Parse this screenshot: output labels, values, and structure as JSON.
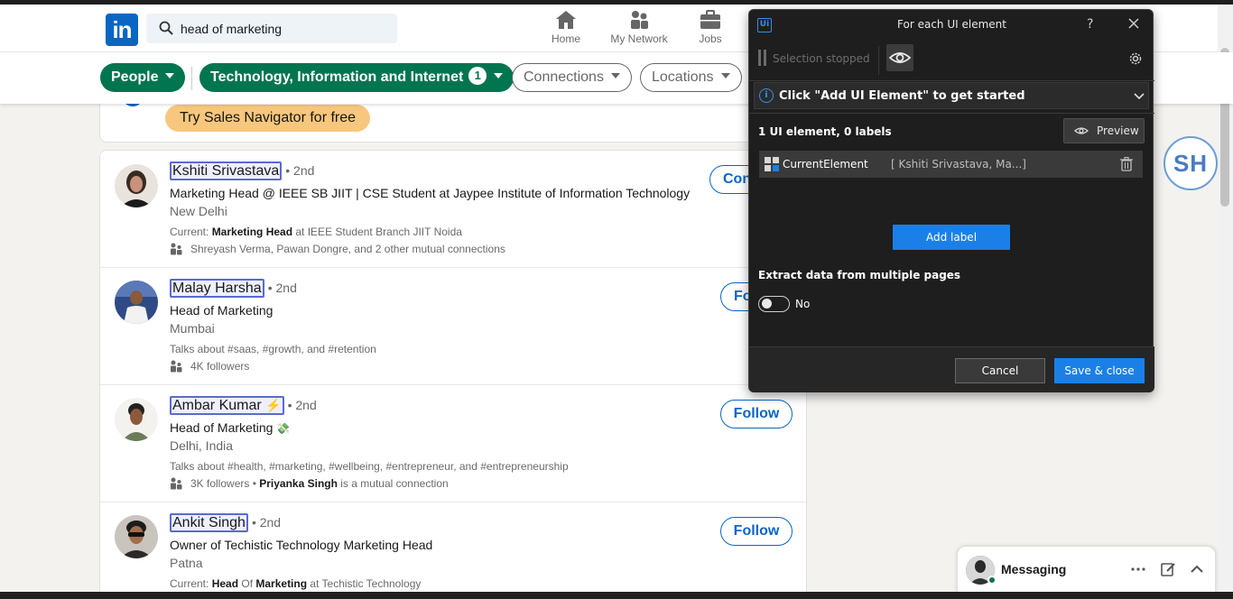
{
  "header": {
    "logo": "in",
    "search_value": "head of marketing",
    "nav": [
      {
        "label": "Home",
        "icon": "home-icon"
      },
      {
        "label": "My Network",
        "icon": "my-network-icon"
      },
      {
        "label": "Jobs",
        "icon": "jobs-icon"
      }
    ]
  },
  "filters": {
    "people": "People",
    "industry": "Technology, Information and Internet",
    "industry_count": "1",
    "connections": "Connections",
    "locations": "Locations"
  },
  "promo": {
    "sales_nav": "Try Sales Navigator for free"
  },
  "results": [
    {
      "name": "Kshiti Srivastava",
      "degree": "• 2nd",
      "headline": "Marketing Head @ IEEE SB JIIT | CSE Student at Jaypee Institute of Information Technology",
      "location": "New Delhi",
      "sub_prefix": "Current: ",
      "sub_bold": "Marketing Head",
      "sub_suffix": " at IEEE Student Branch JIIT Noida",
      "mutual": "Shreyash Verma, Pawan Dongre, and 2 other mutual connections",
      "action": "Con"
    },
    {
      "name": "Malay Harsha",
      "degree": "• 2nd",
      "headline": "Head of Marketing",
      "location": "Mumbai",
      "sub": "Talks about #saas, #growth, and #retention",
      "mutual": "4K followers",
      "action": "Fo"
    },
    {
      "name": "Ambar Kumar",
      "name_emoji": "⚡",
      "degree": "• 2nd",
      "headline": "Head of Marketing",
      "headline_emoji": "💸",
      "location": "Delhi, India",
      "sub": "Talks about #health, #marketing, #wellbeing, #entrepreneur, and #entrepreneurship",
      "mutual_prefix": "3K followers • ",
      "mutual_bold": "Priyanka Singh",
      "mutual_suffix": " is a mutual connection",
      "action": "Follow"
    },
    {
      "name": "Ankit Singh",
      "degree": "• 2nd",
      "headline": "Owner of Techistic Technology Marketing Head",
      "location": "Patna",
      "sub_prefix": "Current: ",
      "sub_bold": "Head",
      "sub_mid": " Of ",
      "sub_bold2": "Marketing",
      "sub_suffix": " at Techistic Technology",
      "action": "Follow"
    }
  ],
  "profile_badge": "SH",
  "messaging": {
    "label": "Messaging"
  },
  "dialog": {
    "logo": "Ui",
    "title": "For each UI element",
    "help": "?",
    "selection_status": "Selection stopped",
    "info": "Click \"Add UI Element\" to get started",
    "count_label": "1 UI element, 0 labels",
    "preview": "Preview",
    "element_name": "CurrentElement",
    "element_value": "[ Kshiti Srivastava, Ma...]",
    "add_label": "Add label",
    "extract_label": "Extract data from multiple pages",
    "toggle_value": "No",
    "cancel": "Cancel",
    "save": "Save & close"
  },
  "colors": {
    "linkedin_blue": "#0a66c2",
    "filter_green": "#01754f",
    "uipath_blue": "#1a80e8",
    "dialog_bg": "#1e1e1e"
  }
}
